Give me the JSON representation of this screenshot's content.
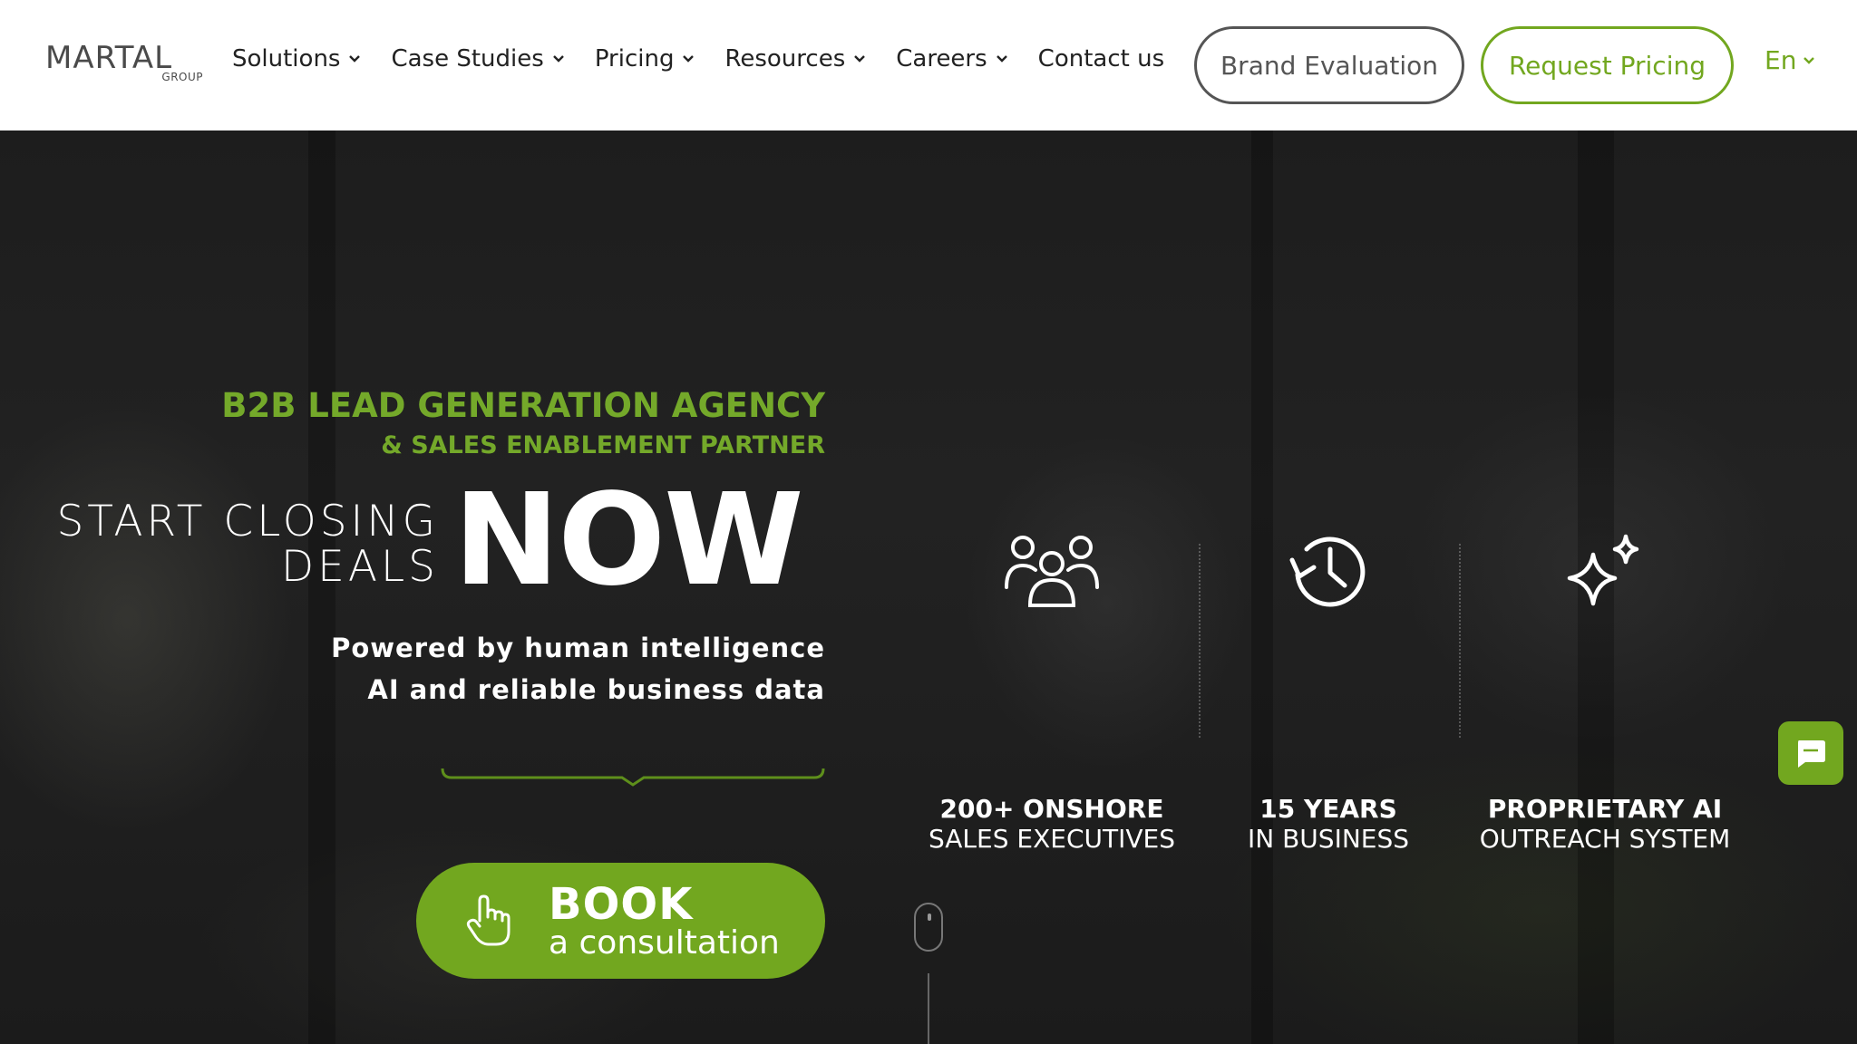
{
  "header": {
    "logo": {
      "name": "MARTAL",
      "sub": "GROUP"
    },
    "nav": [
      {
        "label": "Solutions",
        "has_dropdown": true
      },
      {
        "label": "Case Studies",
        "has_dropdown": true
      },
      {
        "label": "Pricing",
        "has_dropdown": true
      },
      {
        "label": "Resources",
        "has_dropdown": true
      },
      {
        "label": "Careers",
        "has_dropdown": true
      },
      {
        "label": "Contact us",
        "has_dropdown": false
      }
    ],
    "brand_evaluation_label": "Brand Evaluation",
    "request_pricing_label": "Request Pricing",
    "language": "En"
  },
  "hero": {
    "tagline": "B2B LEAD GENERATION AGENCY",
    "tagline_sub": "& SALES ENABLEMENT PARTNER",
    "headline_line1": "START CLOSING",
    "headline_line2": "DEALS",
    "headline_now": "NOW",
    "powered_line1": "Powered by human intelligence",
    "powered_line2": "AI and reliable business data",
    "cta": {
      "main": "BOOK",
      "sub": "a consultation",
      "icon": "pointer-hand-icon"
    }
  },
  "stats": [
    {
      "icon": "team-icon",
      "bold": "200+ ONSHORE",
      "light": "SALES EXECUTIVES"
    },
    {
      "icon": "history-clock-icon",
      "bold": "15 YEARS",
      "light": "IN BUSINESS"
    },
    {
      "icon": "sparkles-icon",
      "bold": "PROPRIETARY AI",
      "light": "OUTREACH SYSTEM"
    }
  ],
  "colors": {
    "accent": "#72a71f",
    "dark": "#1b1b1b",
    "white": "#ffffff",
    "nav_text": "#222222"
  },
  "chat": {
    "icon": "chat-bubble-icon"
  }
}
